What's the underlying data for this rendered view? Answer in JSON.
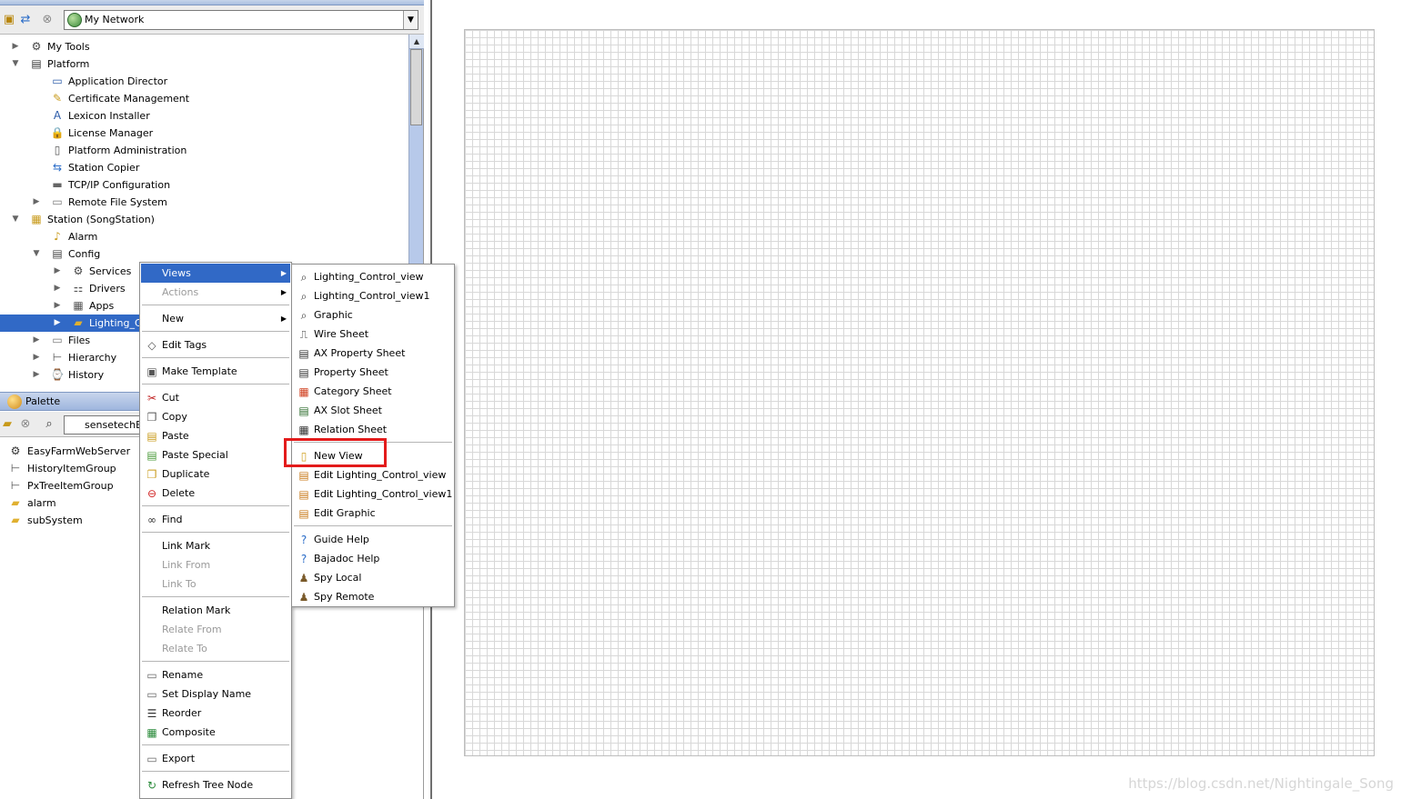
{
  "nav": {
    "combo_value": "My Network",
    "tree": [
      {
        "label": "My Tools",
        "depth": 0,
        "expander": "collapsed",
        "icon": "gear-icon"
      },
      {
        "label": "Platform",
        "depth": 0,
        "expander": "expanded",
        "icon": "server-icon"
      },
      {
        "label": "Application Director",
        "depth": 1,
        "expander": "none",
        "icon": "monitor-icon"
      },
      {
        "label": "Certificate Management",
        "depth": 1,
        "expander": "none",
        "icon": "certificate-icon"
      },
      {
        "label": "Lexicon Installer",
        "depth": 1,
        "expander": "none",
        "icon": "lexicon-icon"
      },
      {
        "label": "License Manager",
        "depth": 1,
        "expander": "none",
        "icon": "lock-icon"
      },
      {
        "label": "Platform Administration",
        "depth": 1,
        "expander": "none",
        "icon": "document-icon"
      },
      {
        "label": "Station Copier",
        "depth": 1,
        "expander": "none",
        "icon": "copy-arrows-icon"
      },
      {
        "label": "TCP/IP Configuration",
        "depth": 1,
        "expander": "none",
        "icon": "network-card-icon"
      },
      {
        "label": "Remote File System",
        "depth": 1,
        "expander": "collapsed",
        "icon": "drive-icon"
      },
      {
        "label": "Station (SongStation)",
        "depth": 0,
        "expander": "expanded",
        "icon": "station-icon"
      },
      {
        "label": "Alarm",
        "depth": 1,
        "expander": "none",
        "icon": "bell-icon"
      },
      {
        "label": "Config",
        "depth": 1,
        "expander": "expanded",
        "icon": "config-icon"
      },
      {
        "label": "Services",
        "depth": 2,
        "expander": "collapsed",
        "icon": "gear-icon"
      },
      {
        "label": "Drivers",
        "depth": 2,
        "expander": "collapsed",
        "icon": "driver-icon"
      },
      {
        "label": "Apps",
        "depth": 2,
        "expander": "collapsed",
        "icon": "apps-icon"
      },
      {
        "label": "Lighting_Co",
        "depth": 2,
        "expander": "collapsed",
        "icon": "folder-icon",
        "selected": true
      },
      {
        "label": "Files",
        "depth": 1,
        "expander": "collapsed",
        "icon": "drive-icon"
      },
      {
        "label": "Hierarchy",
        "depth": 1,
        "expander": "collapsed",
        "icon": "hierarchy-icon"
      },
      {
        "label": "History",
        "depth": 1,
        "expander": "collapsed",
        "icon": "history-icon"
      }
    ]
  },
  "palette": {
    "title": "Palette",
    "combo_value": "sensetechEa",
    "items": [
      {
        "label": "EasyFarmWebServer",
        "icon": "web-server-icon"
      },
      {
        "label": "HistoryItemGroup",
        "icon": "hierarchy-icon"
      },
      {
        "label": "PxTreeItemGroup",
        "icon": "hierarchy-icon"
      },
      {
        "label": "alarm",
        "icon": "folder-icon"
      },
      {
        "label": "subSystem",
        "icon": "folder-icon"
      }
    ]
  },
  "context_menu": {
    "items": [
      {
        "label": "Views",
        "submenu": true,
        "active": true
      },
      {
        "label": "Actions",
        "submenu": true,
        "disabled": true
      },
      {
        "sep": true
      },
      {
        "label": "New",
        "submenu": true
      },
      {
        "sep": true
      },
      {
        "label": "Edit Tags",
        "icon": "tag-icon"
      },
      {
        "sep": true
      },
      {
        "label": "Make Template",
        "icon": "template-icon"
      },
      {
        "sep": true
      },
      {
        "label": "Cut",
        "icon": "scissors-icon"
      },
      {
        "label": "Copy",
        "icon": "copy-icon"
      },
      {
        "label": "Paste",
        "icon": "paste-icon"
      },
      {
        "label": "Paste Special",
        "icon": "paste-special-icon"
      },
      {
        "label": "Duplicate",
        "icon": "duplicate-icon"
      },
      {
        "label": "Delete",
        "icon": "delete-icon"
      },
      {
        "sep": true
      },
      {
        "label": "Find",
        "icon": "binoculars-icon"
      },
      {
        "sep": true
      },
      {
        "label": "Link Mark"
      },
      {
        "label": "Link From",
        "disabled": true
      },
      {
        "label": "Link To",
        "disabled": true
      },
      {
        "sep": true
      },
      {
        "label": "Relation Mark"
      },
      {
        "label": "Relate From",
        "disabled": true
      },
      {
        "label": "Relate To",
        "disabled": true
      },
      {
        "sep": true
      },
      {
        "label": "Rename",
        "icon": "rename-icon"
      },
      {
        "label": "Set Display Name",
        "icon": "rename-icon"
      },
      {
        "label": "Reorder",
        "icon": "reorder-icon"
      },
      {
        "label": "Composite",
        "icon": "composite-icon"
      },
      {
        "sep": true
      },
      {
        "label": "Export",
        "icon": "export-icon"
      },
      {
        "sep": true
      },
      {
        "label": "Refresh Tree Node",
        "icon": "refresh-icon"
      }
    ]
  },
  "views_menu": {
    "items": [
      {
        "label": "Lighting_Control_view",
        "icon": "magnifier-icon"
      },
      {
        "label": "Lighting_Control_view1",
        "icon": "magnifier-icon"
      },
      {
        "label": "Graphic",
        "icon": "magnifier-icon"
      },
      {
        "label": "Wire Sheet",
        "icon": "wire-sheet-icon"
      },
      {
        "label": "AX Property Sheet",
        "icon": "property-sheet-icon"
      },
      {
        "label": "Property Sheet",
        "icon": "property-sheet-icon"
      },
      {
        "label": "Category Sheet",
        "icon": "category-sheet-icon"
      },
      {
        "label": "AX Slot Sheet",
        "icon": "slot-sheet-icon"
      },
      {
        "label": "Relation Sheet",
        "icon": "relation-sheet-icon"
      },
      {
        "sep": true
      },
      {
        "label": "New View",
        "icon": "new-view-icon",
        "highlighted": true
      },
      {
        "label": "Edit Lighting_Control_view",
        "icon": "edit-view-icon"
      },
      {
        "label": "Edit Lighting_Control_view1",
        "icon": "edit-view-icon"
      },
      {
        "label": "Edit Graphic",
        "icon": "edit-view-icon"
      },
      {
        "sep": true
      },
      {
        "label": "Guide Help",
        "icon": "help-icon"
      },
      {
        "label": "Bajadoc Help",
        "icon": "help-icon"
      },
      {
        "label": "Spy Local",
        "icon": "spy-icon"
      },
      {
        "label": "Spy Remote",
        "icon": "spy-icon"
      }
    ]
  },
  "colors": {
    "selection": "#3169c6",
    "highlight_box": "#e31b1b",
    "grid_line": "#d8d8d8"
  },
  "watermark": "https://blog.csdn.net/Nightingale_Song"
}
